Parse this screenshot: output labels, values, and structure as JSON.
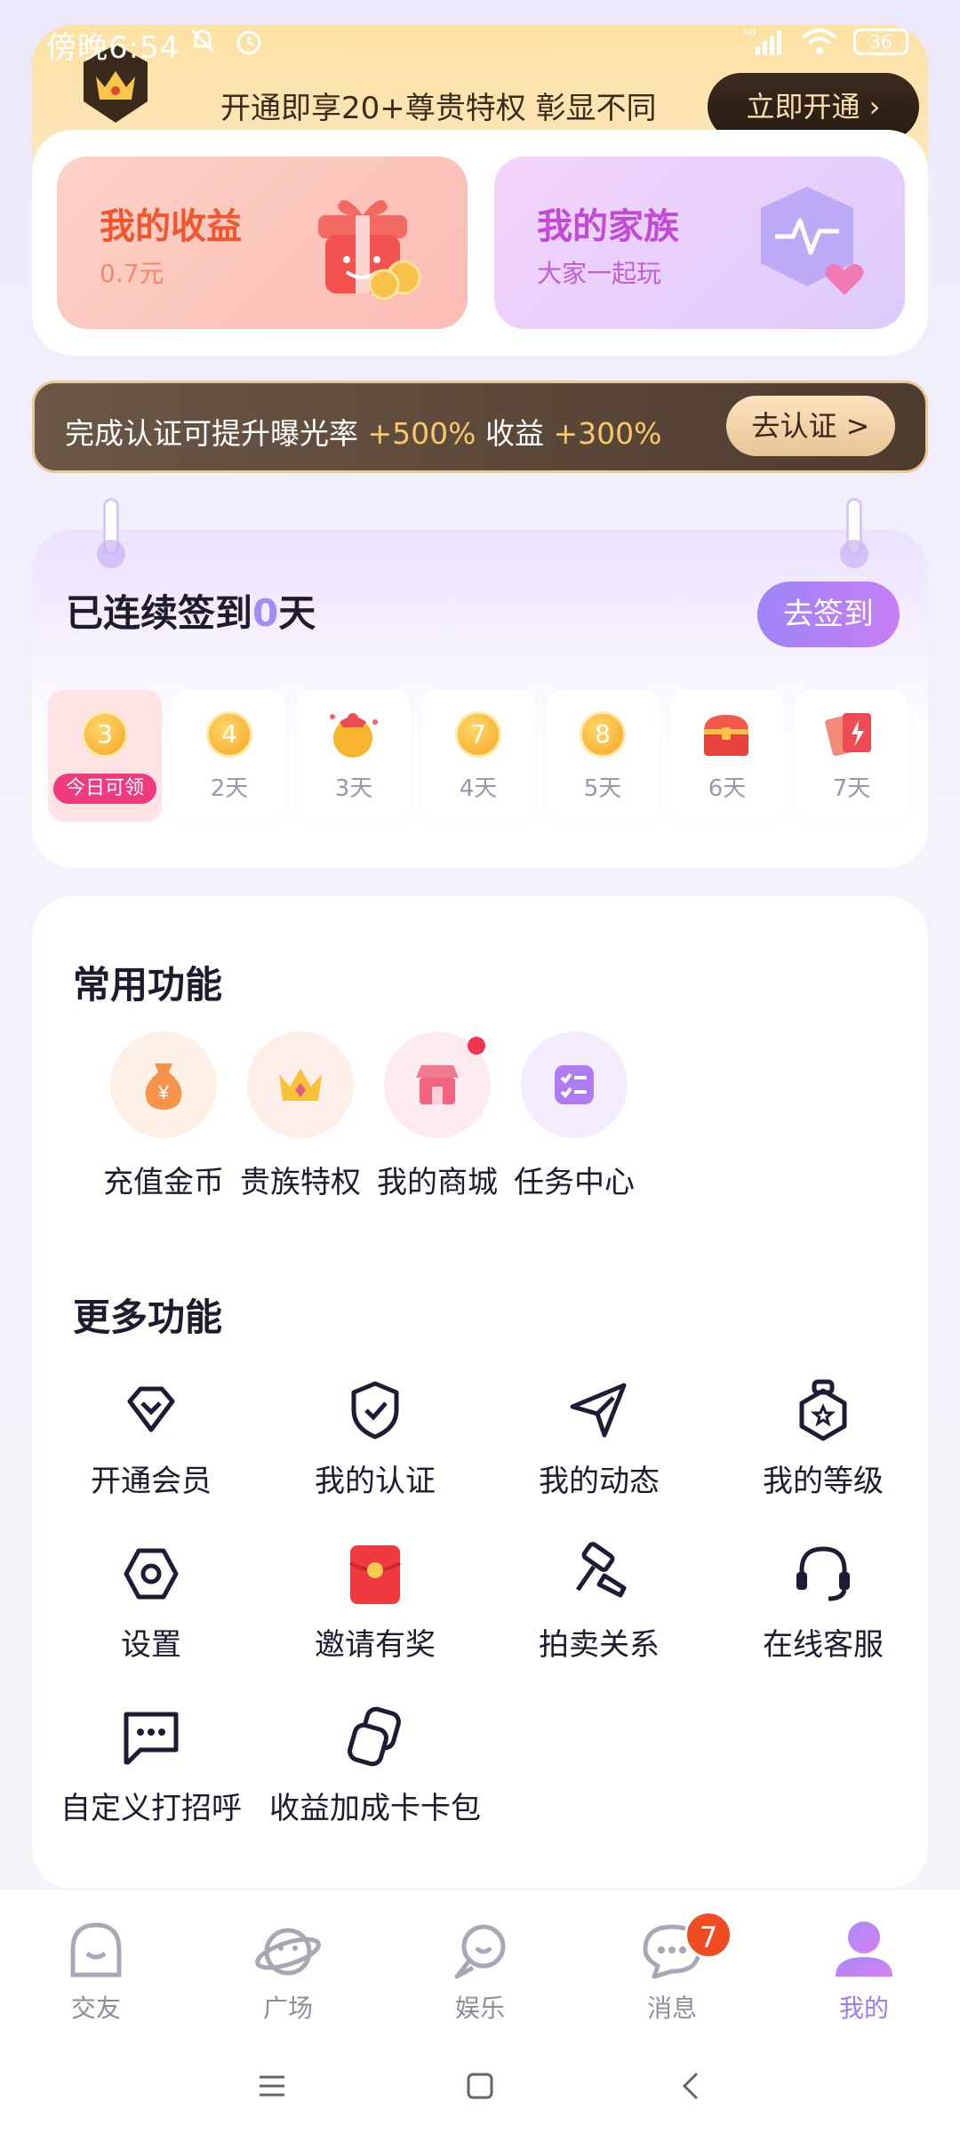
{
  "status_bar": {
    "time": "傍晚6:54",
    "network": "HD",
    "battery": "36"
  },
  "vip_banner": {
    "text": "开通即享20+尊贵特权 彰显不同",
    "button_label": "立即开通 ›"
  },
  "cards": {
    "earnings": {
      "title": "我的收益",
      "value": "0.7元"
    },
    "family": {
      "title": "我的家族",
      "subtitle": "大家一起玩"
    }
  },
  "verify_banner": {
    "text_1": "完成认证可提升曝光率 ",
    "highlight_1": "+500%",
    "text_2": " 收益 ",
    "highlight_2": "+300%",
    "button_label": "去认证 >"
  },
  "signin": {
    "title_prefix": "已连续签到",
    "days_count": "0",
    "title_suffix": "天",
    "button_label": "去签到",
    "days": [
      {
        "coin": "3",
        "label": "今日可领",
        "today": true
      },
      {
        "coin": "4",
        "label": "2天"
      },
      {
        "icon": "gift-bag-icon",
        "label": "3天"
      },
      {
        "coin": "7",
        "label": "4天"
      },
      {
        "coin": "8",
        "label": "5天"
      },
      {
        "icon": "treasure-chest-icon",
        "label": "6天"
      },
      {
        "icon": "cards-icon",
        "label": "7天"
      }
    ]
  },
  "common_functions": {
    "title": "常用功能",
    "items": [
      {
        "label": "充值金币",
        "icon": "money-bag-icon"
      },
      {
        "label": "贵族特权",
        "icon": "crown-icon"
      },
      {
        "label": "我的商城",
        "icon": "shop-icon"
      },
      {
        "label": "任务中心",
        "icon": "task-list-icon"
      }
    ]
  },
  "more_functions": {
    "title": "更多功能",
    "items": [
      {
        "label": "开通会员",
        "icon": "diamond-icon"
      },
      {
        "label": "我的认证",
        "icon": "shield-check-icon"
      },
      {
        "label": "我的动态",
        "icon": "paper-plane-icon"
      },
      {
        "label": "我的等级",
        "icon": "level-badge-icon"
      },
      {
        "label": "设置",
        "icon": "settings-icon"
      },
      {
        "label": "邀请有奖",
        "icon": "red-envelope-icon"
      },
      {
        "label": "拍卖关系",
        "icon": "gavel-icon"
      },
      {
        "label": "在线客服",
        "icon": "headset-icon"
      },
      {
        "label": "自定义打招呼",
        "icon": "chat-bubble-icon"
      },
      {
        "label": "收益加成卡卡包",
        "icon": "card-stack-icon"
      }
    ]
  },
  "tab_bar": {
    "tabs": [
      {
        "label": "交友",
        "icon": "friends-icon"
      },
      {
        "label": "广场",
        "icon": "planet-icon"
      },
      {
        "label": "娱乐",
        "icon": "search-bubble-icon"
      },
      {
        "label": "消息",
        "icon": "message-icon",
        "badge": "7"
      },
      {
        "label": "我的",
        "icon": "profile-icon",
        "active": true
      }
    ]
  },
  "colors": {
    "accent": "#9b7cf5",
    "vip_gold": "#fde2a4",
    "earnings_orange": "#f0572c",
    "family_purple": "#c24ad8",
    "badge_red": "#f04b22"
  }
}
